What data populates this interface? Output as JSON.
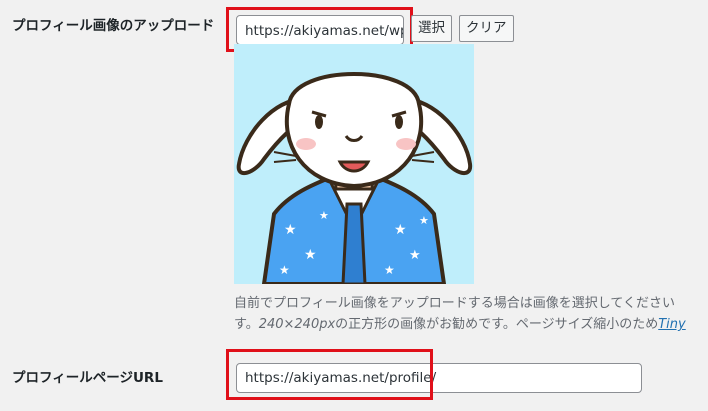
{
  "upload": {
    "label": "プロフィール画像のアップロード",
    "input_value": "https://akiyamas.net/wp",
    "select_button": "選択",
    "clear_button": "クリア",
    "avatar_alt": "うさぎのアバター",
    "description_line1": "自前でプロフィール画像をアップロードする場合は画像を選択してください",
    "description_line2_prefix": "す。",
    "description_line2_size": "240×240px",
    "description_line2_mid": "の正方形の画像がお勧めです。ページサイズ縮小のため",
    "description_line2_link": "Tiny"
  },
  "profile_page": {
    "label": "プロフィールページURL",
    "input_value": "https://akiyamas.net/profile/"
  },
  "colors": {
    "highlight": "#e0101a",
    "avatar_background": "#bfeefb",
    "jacket": "#4aa3f2"
  }
}
